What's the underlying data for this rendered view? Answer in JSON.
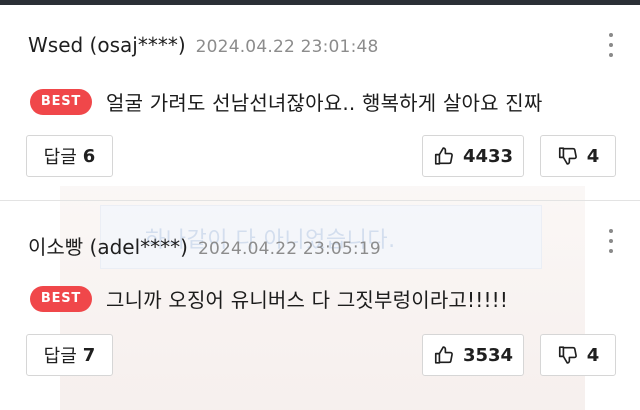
{
  "comments": [
    {
      "author": "Wsed (osaj****)",
      "timestamp": "2024.04.22 23:01:48",
      "badge": "BEST",
      "text": "얼굴 가려도 선남선녀잖아요.. 행복하게 살아요 진짜",
      "reply_label": "답글",
      "reply_count": "6",
      "likes": "4433",
      "dislikes": "4"
    },
    {
      "author": "이소빵 (adel****)",
      "timestamp": "2024.04.22 23:05:19",
      "badge": "BEST",
      "text": "그니까 오징어 유니버스 다 그짓부렁이라고!!!!!",
      "reply_label": "답글",
      "reply_count": "7",
      "likes": "3534",
      "dislikes": "4"
    }
  ],
  "ghost_text": "하나같이 다 아니었습니다.",
  "icons": {
    "like": "thumbs-up-icon",
    "dislike": "thumbs-down-icon",
    "more": "more-vertical-icon"
  },
  "colors": {
    "best_badge": "#f0474a",
    "timestamp": "#8c8c8c",
    "border": "#d6d6d6"
  }
}
